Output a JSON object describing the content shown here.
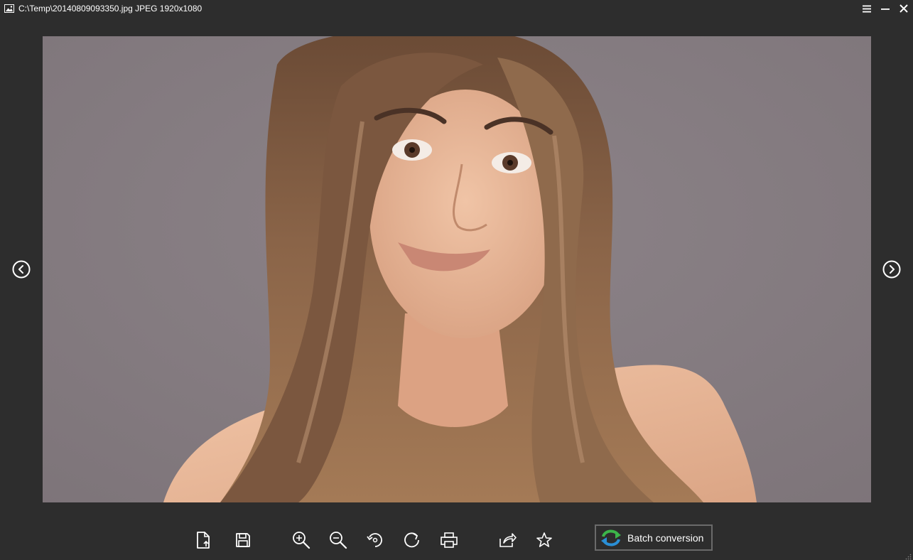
{
  "window": {
    "title": "C:\\Temp\\20140809093350.jpg JPEG 1920x1080"
  },
  "titlebar": {
    "controls": [
      {
        "name": "menu-icon"
      },
      {
        "name": "minimize-icon"
      },
      {
        "name": "close-icon"
      }
    ]
  },
  "navigation": {
    "prev_icon": "chevron-left-circle-icon",
    "next_icon": "chevron-right-circle-icon"
  },
  "toolbar": {
    "tools": [
      {
        "icon": "open-file-icon"
      },
      {
        "icon": "save-icon"
      },
      {
        "icon": "zoom-in-icon"
      },
      {
        "icon": "zoom-out-icon"
      },
      {
        "icon": "rotate-left-icon"
      },
      {
        "icon": "rotate-right-icon"
      },
      {
        "icon": "print-icon"
      },
      {
        "icon": "share-icon"
      },
      {
        "icon": "favorite-star-icon"
      }
    ],
    "batch_label": "Batch conversion"
  },
  "colors": {
    "background": "#2d2d2d",
    "photo_backdrop": "#857c81",
    "icon": "#ffffff",
    "batch_border": "#6a6a6a",
    "batch_icon_green": "#3cb54a",
    "batch_icon_blue": "#2a8fd6"
  }
}
